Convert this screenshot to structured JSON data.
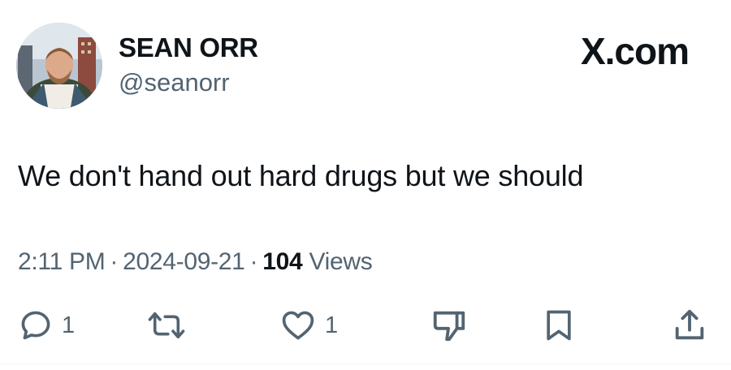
{
  "author": {
    "display_name": "SEAN ORR",
    "handle": "@seanorr"
  },
  "brand": {
    "label": "X.com"
  },
  "tweet": {
    "text": "We don't hand out hard drugs but we should"
  },
  "meta": {
    "time": "2:11 PM",
    "separator": "·",
    "date": "2024-09-21",
    "views_count": "104",
    "views_label": "Views"
  },
  "actions": {
    "reply": {
      "icon": "reply-icon",
      "count": "1"
    },
    "retweet": {
      "icon": "retweet-icon",
      "count": ""
    },
    "like": {
      "icon": "heart-icon",
      "count": "1"
    },
    "dislike": {
      "icon": "thumbs-down-icon"
    },
    "bookmark": {
      "icon": "bookmark-icon"
    },
    "share": {
      "icon": "share-icon"
    }
  },
  "colors": {
    "text_primary": "#0f1419",
    "text_secondary": "#536471",
    "background": "#ffffff"
  }
}
